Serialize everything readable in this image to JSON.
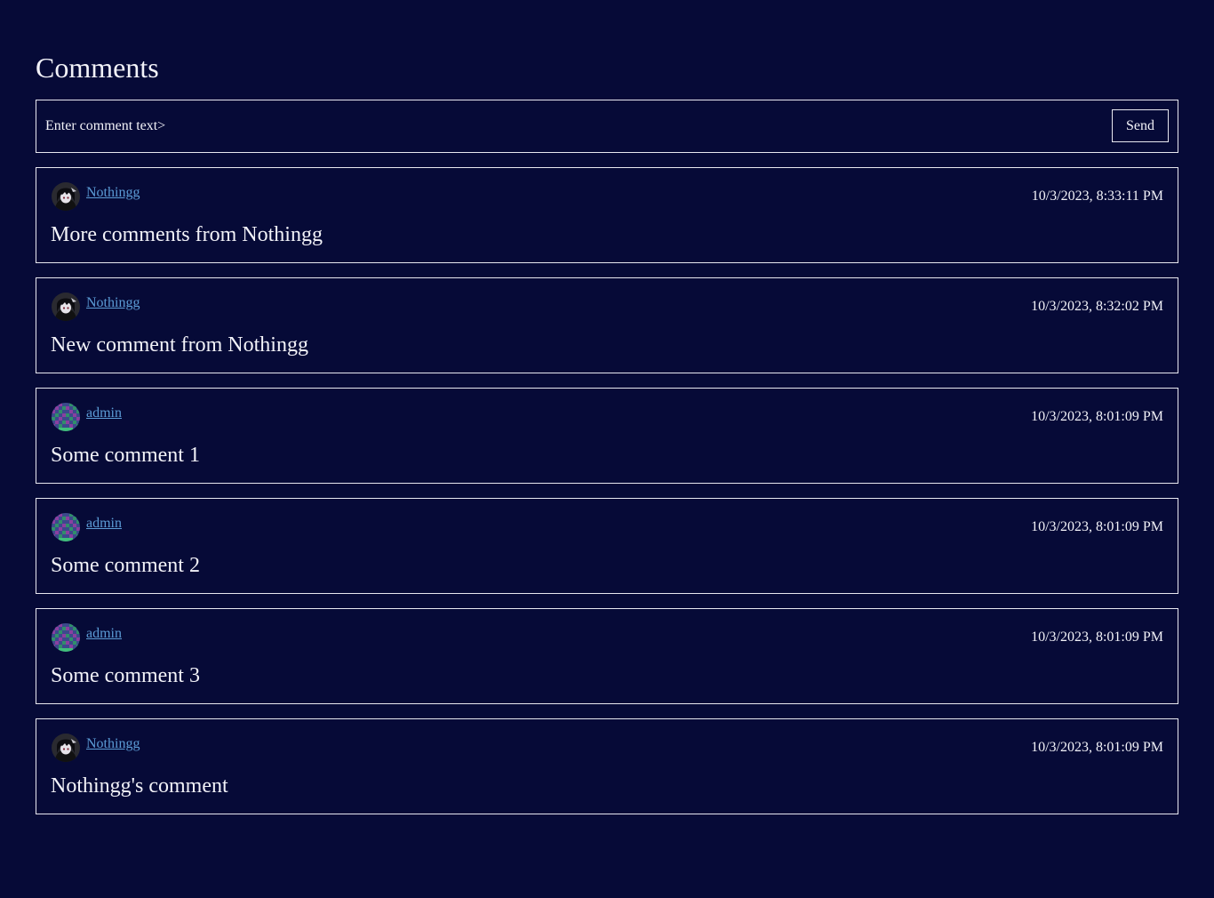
{
  "page": {
    "title": "Comments"
  },
  "composer": {
    "placeholder": "Enter comment text>",
    "send_label": "Send"
  },
  "colors": {
    "background": "#060a37",
    "text": "#f2f2f8",
    "link": "#5b9bd5",
    "border": "#e8e8f0"
  },
  "comments": [
    {
      "author": "Nothingg",
      "avatar": "anime-character-avatar-icon",
      "timestamp": "10/3/2023, 8:33:11 PM",
      "text": "More comments from Nothingg"
    },
    {
      "author": "Nothingg",
      "avatar": "anime-character-avatar-icon",
      "timestamp": "10/3/2023, 8:32:02 PM",
      "text": "New comment from Nothingg"
    },
    {
      "author": "admin",
      "avatar": "pixel-identicon-avatar-icon",
      "timestamp": "10/3/2023, 8:01:09 PM",
      "text": "Some comment 1"
    },
    {
      "author": "admin",
      "avatar": "pixel-identicon-avatar-icon",
      "timestamp": "10/3/2023, 8:01:09 PM",
      "text": "Some comment 2"
    },
    {
      "author": "admin",
      "avatar": "pixel-identicon-avatar-icon",
      "timestamp": "10/3/2023, 8:01:09 PM",
      "text": "Some comment 3"
    },
    {
      "author": "Nothingg",
      "avatar": "anime-character-avatar-icon",
      "timestamp": "10/3/2023, 8:01:09 PM",
      "text": "Nothingg's comment"
    }
  ]
}
